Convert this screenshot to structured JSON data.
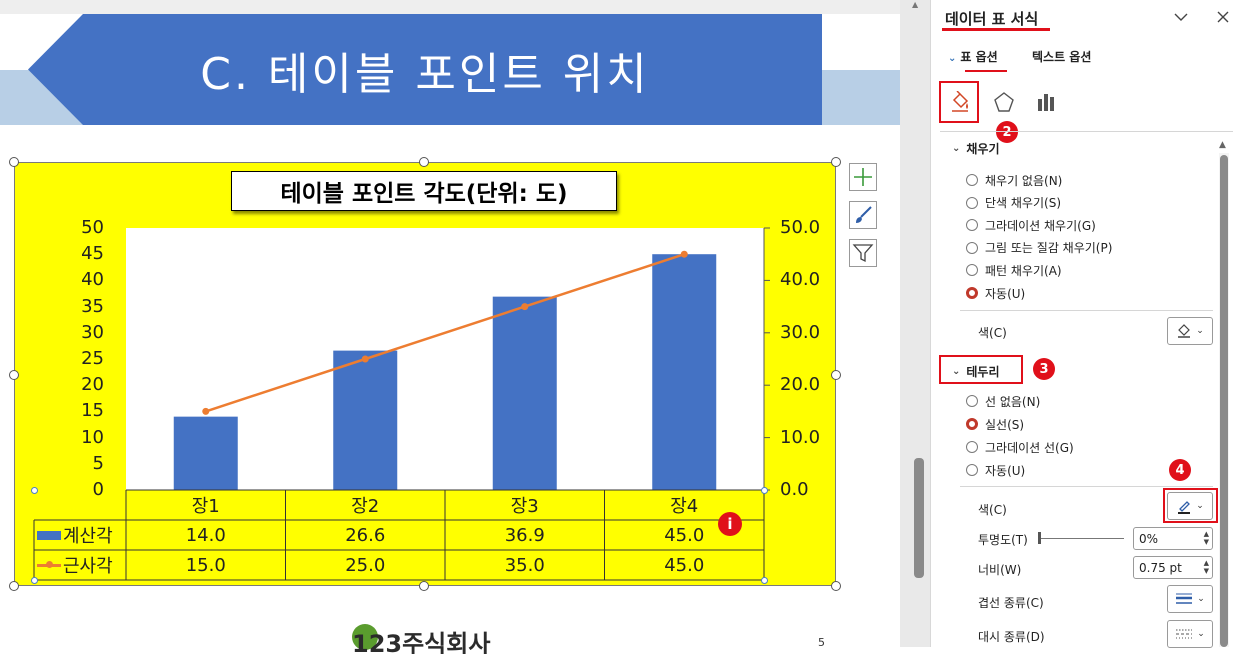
{
  "slide": {
    "banner_title": "C. 테이블 포인트 위치",
    "logo_text": "123주식회사",
    "page_number": "5"
  },
  "chart_data": {
    "type": "bar",
    "title": "테이블 포인트 각도(단위: 도)",
    "categories": [
      "장1",
      "장2",
      "장3",
      "장4"
    ],
    "series": [
      {
        "name": "계산각",
        "type": "bar",
        "axis": "primary",
        "values": [
          14.0,
          26.6,
          36.9,
          45.0
        ],
        "color": "#4472c4"
      },
      {
        "name": "근사각",
        "type": "line",
        "axis": "secondary",
        "values": [
          15.0,
          25.0,
          35.0,
          45.0
        ],
        "color": "#ed7d31"
      }
    ],
    "ylim": [
      0,
      50
    ],
    "y_ticks": [
      "0",
      "5",
      "10",
      "15",
      "20",
      "25",
      "30",
      "35",
      "40",
      "45",
      "50"
    ],
    "y2lim": [
      0,
      50
    ],
    "y2_ticks": [
      "0.0",
      "10.0",
      "20.0",
      "30.0",
      "40.0",
      "50.0"
    ],
    "data_table": {
      "rows": [
        {
          "label": "계산각",
          "values": [
            "14.0",
            "26.6",
            "36.9",
            "45.0"
          ]
        },
        {
          "label": "근사각",
          "values": [
            "15.0",
            "25.0",
            "35.0",
            "45.0"
          ]
        }
      ]
    },
    "chart_background": "#ffff00",
    "plot_background": "#ffffff",
    "grid": false,
    "legend": "data-table"
  },
  "chart_tools": {
    "elements": "plus-icon",
    "styles": "brush-icon",
    "filters": "filter-icon"
  },
  "info_badge": "i",
  "pane": {
    "title": "데이터 표 서식",
    "tab_options": "표 옵션",
    "tab_text": "텍스트 옵션",
    "badges": [
      "2",
      "3",
      "4"
    ],
    "fill": {
      "header": "채우기",
      "options": [
        "채우기 없음(N)",
        "단색 채우기(S)",
        "그라데이션 채우기(G)",
        "그림 또는 질감 채우기(P)",
        "패턴 채우기(A)",
        "자동(U)"
      ],
      "selected": "자동(U)",
      "color_label": "색(C)"
    },
    "border": {
      "header": "테두리",
      "options": [
        "선 없음(N)",
        "실선(S)",
        "그라데이션 선(G)",
        "자동(U)"
      ],
      "selected": "실선(S)",
      "color_label": "색(C)",
      "transparency_label": "투명도(T)",
      "transparency_value": "0%",
      "transparency_level": 0,
      "width_label": "너비(W)",
      "width_value": "0.75 pt",
      "compound_label": "겹선 종류(C)",
      "dash_label": "대시 종류(D)"
    },
    "accent_color": "#e0101a"
  }
}
